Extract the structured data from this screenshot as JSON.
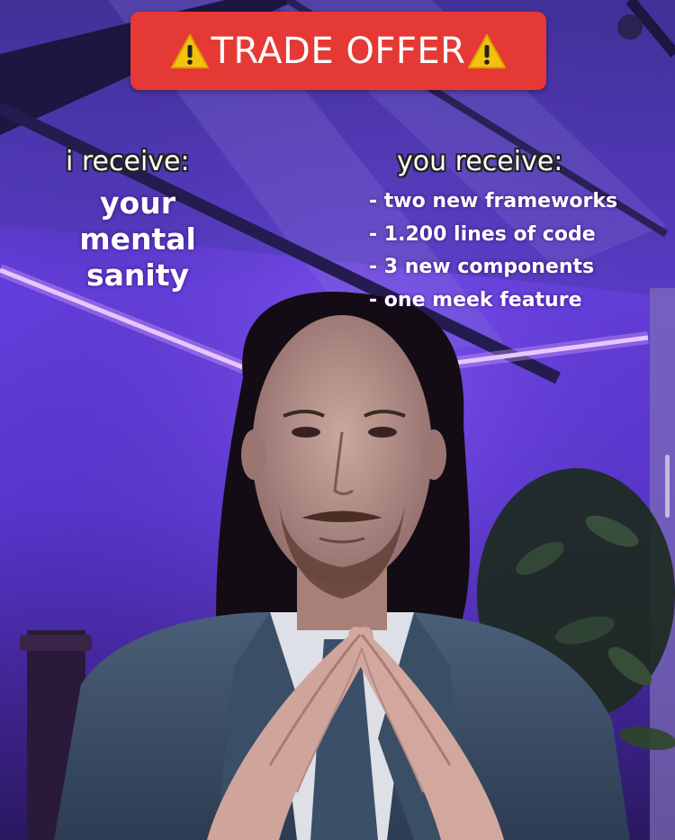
{
  "banner": {
    "text": "TRADE OFFER",
    "icon": "warning-icon",
    "bg_color": "#e53935"
  },
  "left": {
    "label": "i receive:",
    "item": "your\nmental\nsanity"
  },
  "right": {
    "label": "you receive:",
    "items": [
      "- two new frameworks",
      "- 1.200 lines of code",
      "- 3 new components",
      "- one meek feature"
    ]
  }
}
